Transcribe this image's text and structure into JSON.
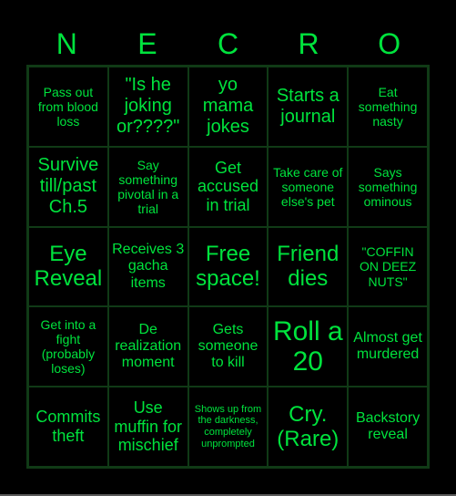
{
  "header": {
    "letters": [
      "N",
      "E",
      "C",
      "R",
      "O"
    ]
  },
  "board": {
    "cells": [
      "Pass out from blood loss",
      "\"Is he joking or????\"",
      "yo mama jokes",
      "Starts a journal",
      "Eat something nasty",
      "Survive till/past Ch.5",
      "Say something pivotal in a trial",
      "Get accused in trial",
      "Take care of someone else's pet",
      "Says something ominous",
      "Eye Reveal",
      "Receives 3 gacha items",
      "Free space!",
      "Friend dies",
      "\"COFFIN ON DEEZ NUTS\"",
      "Get into a fight (probably loses)",
      "De realization moment",
      "Gets someone to kill",
      "Roll a 20",
      "Almost get murdered",
      "Commits theft",
      "Use muffin for mischief",
      "Shows up from the darkness, completely unprompted",
      "Cry. (Rare)",
      "Backstory reveal"
    ]
  },
  "colors": {
    "text": "#00e33d",
    "grid": "#103a16",
    "background": "#000000"
  }
}
